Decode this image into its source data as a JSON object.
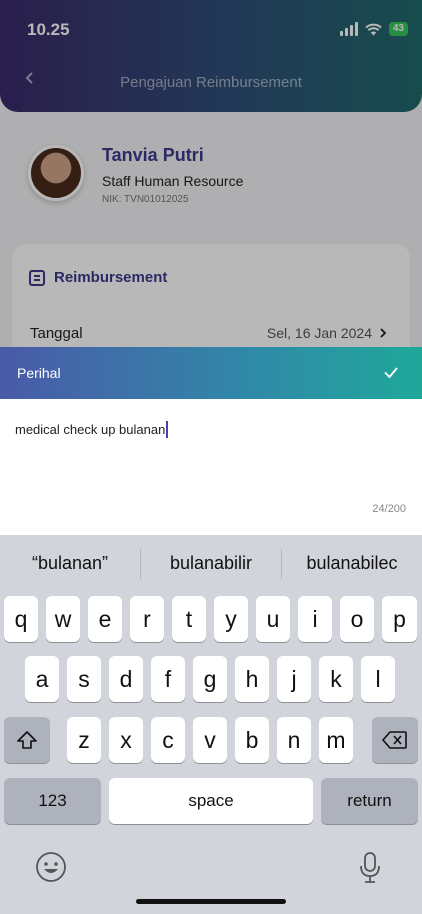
{
  "status_bar": {
    "time": "10.25",
    "battery": "43"
  },
  "header": {
    "title": "Pengajuan Reimbursement"
  },
  "profile": {
    "name": "Tanvia Putri",
    "role": "Staff Human Resource",
    "nik": "NIK: TVN01012025"
  },
  "card": {
    "section_title": "Reimbursement",
    "date_label": "Tanggal",
    "date_value": "Sel, 16 Jan 2024"
  },
  "sheet": {
    "title": "Perihal",
    "input_value": "medical check up bulanan",
    "counter": "24/200"
  },
  "keyboard": {
    "suggestions": [
      "“bulanan”",
      "bulanabilir",
      "bulanabilec"
    ],
    "row1": [
      "q",
      "w",
      "e",
      "r",
      "t",
      "y",
      "u",
      "i",
      "o",
      "p"
    ],
    "row2": [
      "a",
      "s",
      "d",
      "f",
      "g",
      "h",
      "j",
      "k",
      "l"
    ],
    "row3": [
      "z",
      "x",
      "c",
      "v",
      "b",
      "n",
      "m"
    ],
    "numbers_label": "123",
    "space_label": "space",
    "return_label": "return"
  }
}
